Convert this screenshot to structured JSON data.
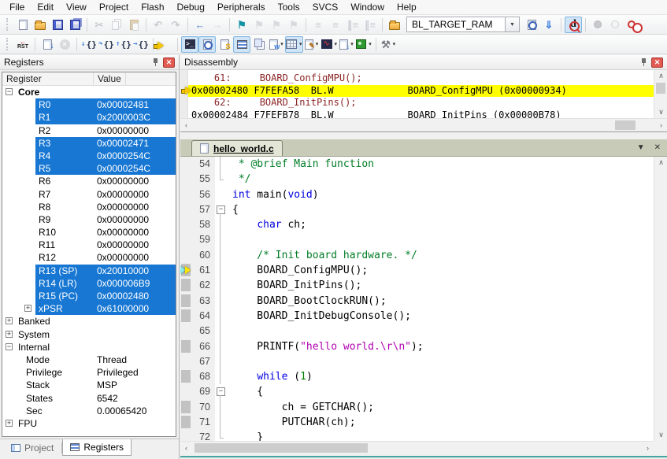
{
  "menu": [
    "File",
    "Edit",
    "View",
    "Project",
    "Flash",
    "Debug",
    "Peripherals",
    "Tools",
    "SVCS",
    "Window",
    "Help"
  ],
  "toolbar": {
    "target": "BL_TARGET_RAM",
    "rst_label": "RST",
    "main": [
      {
        "name": "new-file-icon",
        "kind": "page"
      },
      {
        "name": "open-file-icon",
        "kind": "folder"
      },
      {
        "name": "save-icon",
        "kind": "floppy"
      },
      {
        "name": "save-all-icon",
        "kind": "floppy2"
      },
      {
        "sep": true
      },
      {
        "name": "cut-icon",
        "glyph": "✂",
        "color": "#9a9aa8",
        "disabled": true
      },
      {
        "name": "copy-icon",
        "kind": "copy",
        "disabled": true
      },
      {
        "name": "paste-icon",
        "kind": "paste",
        "disabled": true
      },
      {
        "sep": true
      },
      {
        "name": "undo-icon",
        "glyph": "↶",
        "color": "#9a9aa8",
        "disabled": true
      },
      {
        "name": "redo-icon",
        "glyph": "↷",
        "color": "#9a9aa8",
        "disabled": true
      },
      {
        "sep": true
      },
      {
        "name": "navigate-back-icon",
        "glyph": "←",
        "color": "#4b78c8"
      },
      {
        "name": "navigate-forward-icon",
        "glyph": "→",
        "color": "#b2b2ba",
        "disabled": true
      },
      {
        "sep": true
      },
      {
        "name": "bookmark-toggle-icon",
        "glyph": "⚑",
        "color": "#1391a5"
      },
      {
        "name": "bookmark-prev-icon",
        "glyph": "⚑",
        "color": "#b8b8c0",
        "disabled": true
      },
      {
        "name": "bookmark-next-icon",
        "glyph": "⚑",
        "color": "#b8b8c0",
        "disabled": true
      },
      {
        "name": "bookmark-clear-icon",
        "glyph": "⚑",
        "color": "#b8b8c0",
        "disabled": true
      },
      {
        "sep": true
      },
      {
        "name": "indent-icon",
        "glyph": "≡",
        "color": "#9aa0ae",
        "disabled": true
      },
      {
        "name": "unindent-icon",
        "glyph": "≡",
        "color": "#9aa0ae",
        "disabled": true
      },
      {
        "name": "comment-selection-icon",
        "glyph": "∥≡",
        "color": "#9aa0ae",
        "disabled": true
      },
      {
        "name": "uncomment-selection-icon",
        "glyph": "∥≡",
        "color": "#9aa0ae",
        "disabled": true
      },
      {
        "sep": true
      },
      {
        "name": "target-folder-icon",
        "kind": "folder"
      },
      {
        "name": "target-select",
        "kind": "combo"
      },
      {
        "name": "file-options-icon",
        "kind": "pagemag"
      },
      {
        "name": "find-in-files-icon",
        "glyph": "⇓",
        "color": "#3a7edc"
      },
      {
        "sep": true
      },
      {
        "name": "debug-session-icon",
        "kind": "debugd",
        "active": true
      },
      {
        "sep": true
      },
      {
        "name": "breakpoint-toggle-icon",
        "kind": "bp-f",
        "disabled": true
      },
      {
        "name": "breakpoint-enable-icon",
        "kind": "bp-h",
        "disabled": true
      },
      {
        "name": "breakpoint-kill-all-icon",
        "kind": "bp-k"
      }
    ],
    "debug": [
      {
        "name": "reset-icon",
        "kind": "rst"
      },
      {
        "sep": true
      },
      {
        "name": "run-icon",
        "kind": "run"
      },
      {
        "name": "stop-icon",
        "kind": "stop",
        "glyph": "✕",
        "disabled": true
      },
      {
        "sep": true
      },
      {
        "name": "step-into-icon",
        "kind": "braces",
        "sub": "↓"
      },
      {
        "name": "step-over-icon",
        "kind": "braces",
        "sub": "↷"
      },
      {
        "name": "step-out-icon",
        "kind": "braces",
        "sub": "↑"
      },
      {
        "name": "run-to-cursor-icon",
        "kind": "braces",
        "sub": "→"
      },
      {
        "sep": true
      },
      {
        "name": "show-next-statement-icon",
        "kind": "nextarrow"
      },
      {
        "sep": true
      },
      {
        "name": "command-window-icon",
        "kind": "cmd",
        "glyph": ">_",
        "active": true
      },
      {
        "name": "disassembly-window-icon",
        "kind": "pagemag2",
        "active": true
      },
      {
        "name": "symbol-window-icon",
        "kind": "page-s",
        "ov": "S",
        "ovcolor": "#e0a000"
      },
      {
        "name": "registers-window-icon",
        "kind": "reglines",
        "active": true
      },
      {
        "name": "callstack-window-icon",
        "kind": "pages"
      },
      {
        "name": "watch-window-icon",
        "kind": "page-s",
        "ov": "w",
        "ovcolor": "#3a7edc",
        "dropdown": true
      },
      {
        "name": "memory-window-icon",
        "kind": "grid",
        "dropdown": true,
        "active": true
      },
      {
        "name": "serial-window-icon",
        "kind": "page-s",
        "ov": "✎",
        "ovcolor": "#b06a10",
        "dropdown": true
      },
      {
        "name": "analysis-window-icon",
        "kind": "analysis",
        "glyph": "∿",
        "dropdown": true
      },
      {
        "name": "trace-window-icon",
        "kind": "page-s",
        "ov": "↓",
        "ovcolor": "#3a7edc",
        "dropdown": true
      },
      {
        "name": "system-viewer-icon",
        "kind": "chip",
        "dropdown": true
      },
      {
        "sep": true
      },
      {
        "name": "debug-settings-icon",
        "glyph": "⚒",
        "color": "#7a7a84",
        "dropdown": true
      }
    ]
  },
  "registers_panel": {
    "title": "Registers",
    "columns": [
      "Register",
      "Value"
    ],
    "rows": [
      {
        "label": "Core",
        "lvl": 0,
        "exp": "−",
        "grp": true
      },
      {
        "label": "R0",
        "value": "0x00002481",
        "lvl": 1,
        "sel": true
      },
      {
        "label": "R1",
        "value": "0x2000003C",
        "lvl": 1,
        "sel": true
      },
      {
        "label": "R2",
        "value": "0x00000000",
        "lvl": 1
      },
      {
        "label": "R3",
        "value": "0x00002471",
        "lvl": 1,
        "sel": true
      },
      {
        "label": "R4",
        "value": "0x0000254C",
        "lvl": 1,
        "sel": true
      },
      {
        "label": "R5",
        "value": "0x0000254C",
        "lvl": 1,
        "sel": true
      },
      {
        "label": "R6",
        "value": "0x00000000",
        "lvl": 1
      },
      {
        "label": "R7",
        "value": "0x00000000",
        "lvl": 1
      },
      {
        "label": "R8",
        "value": "0x00000000",
        "lvl": 1
      },
      {
        "label": "R9",
        "value": "0x00000000",
        "lvl": 1
      },
      {
        "label": "R10",
        "value": "0x00000000",
        "lvl": 1
      },
      {
        "label": "R11",
        "value": "0x00000000",
        "lvl": 1
      },
      {
        "label": "R12",
        "value": "0x00000000",
        "lvl": 1
      },
      {
        "label": "R13 (SP)",
        "value": "0x20010000",
        "lvl": 1,
        "sel": true
      },
      {
        "label": "R14 (LR)",
        "value": "0x000006B9",
        "lvl": 1,
        "sel": true
      },
      {
        "label": "R15 (PC)",
        "value": "0x00002480",
        "lvl": 1,
        "sel": true
      },
      {
        "label": "xPSR",
        "value": "0x61000000",
        "lvl": 1,
        "sel": true,
        "exp": "+"
      },
      {
        "label": "Banked",
        "lvl": 0,
        "exp": "+"
      },
      {
        "label": "System",
        "lvl": 0,
        "exp": "+"
      },
      {
        "label": "Internal",
        "lvl": 0,
        "exp": "−"
      },
      {
        "label": "Mode",
        "value": "Thread",
        "lvl": 2
      },
      {
        "label": "Privilege",
        "value": "Privileged",
        "lvl": 2
      },
      {
        "label": "Stack",
        "value": "MSP",
        "lvl": 2
      },
      {
        "label": "States",
        "value": "6542",
        "lvl": 2
      },
      {
        "label": "Sec",
        "value": "0.00065420",
        "lvl": 2
      },
      {
        "label": "FPU",
        "lvl": 0,
        "exp": "+"
      }
    ],
    "tabs": [
      {
        "label": "Project",
        "icon": "project-icon"
      },
      {
        "label": "Registers",
        "icon": "registers-icon",
        "active": true
      }
    ]
  },
  "disassembly": {
    "title": "Disassembly",
    "rows": [
      {
        "kind": "src",
        "text": "    61:     BOARD_ConfigMPU();"
      },
      {
        "kind": "asm",
        "current": true,
        "text": "0x00002480 F7FEFA58  BL.W             BOARD_ConfigMPU (0x00000934)"
      },
      {
        "kind": "src",
        "text": "    62:     BOARD_InitPins();"
      },
      {
        "kind": "asm",
        "text": "0x00002484 F7FEFB78  BL.W             BOARD_InitPins (0x00000B78)"
      }
    ]
  },
  "editor": {
    "tab": "hello_world.c",
    "lines": [
      {
        "no": 54,
        "fold": "line",
        "seg": [
          [
            " * @brief Main function",
            "c"
          ]
        ]
      },
      {
        "no": 55,
        "fold": "end",
        "seg": [
          [
            " */",
            "c"
          ]
        ]
      },
      {
        "no": 56,
        "fold": "",
        "seg": [
          [
            "int",
            "k"
          ],
          [
            " main(",
            "p"
          ],
          [
            "void",
            "k"
          ],
          [
            ")",
            "p"
          ]
        ]
      },
      {
        "no": 57,
        "fold": "box",
        "seg": [
          [
            "{",
            "p"
          ]
        ]
      },
      {
        "no": 58,
        "fold": "line",
        "seg": [
          [
            "    ",
            "p"
          ],
          [
            "char",
            "k"
          ],
          [
            " ch;",
            "p"
          ]
        ]
      },
      {
        "no": 59,
        "fold": "line",
        "seg": []
      },
      {
        "no": 60,
        "fold": "line",
        "seg": [
          [
            "    /* Init board hardware. */",
            "c"
          ]
        ]
      },
      {
        "no": 61,
        "fold": "line",
        "exec": true,
        "cur": true,
        "seg": [
          [
            "    BOARD_ConfigMPU();",
            "p"
          ]
        ]
      },
      {
        "no": 62,
        "fold": "line",
        "exec": true,
        "seg": [
          [
            "    BOARD_InitPins();",
            "p"
          ]
        ]
      },
      {
        "no": 63,
        "fold": "line",
        "exec": true,
        "seg": [
          [
            "    BOARD_BootClockRUN();",
            "p"
          ]
        ]
      },
      {
        "no": 64,
        "fold": "line",
        "exec": true,
        "seg": [
          [
            "    BOARD_InitDebugConsole();",
            "p"
          ]
        ]
      },
      {
        "no": 65,
        "fold": "line",
        "seg": []
      },
      {
        "no": 66,
        "fold": "line",
        "exec": true,
        "seg": [
          [
            "    PRINTF(",
            "p"
          ],
          [
            "\"hello world.\\r\\n\"",
            "s"
          ],
          [
            ");",
            "p"
          ]
        ]
      },
      {
        "no": 67,
        "fold": "line",
        "seg": []
      },
      {
        "no": 68,
        "fold": "line",
        "exec": true,
        "seg": [
          [
            "    ",
            "p"
          ],
          [
            "while",
            "k"
          ],
          [
            " (",
            "p"
          ],
          [
            "1",
            "n"
          ],
          [
            ")",
            "p"
          ]
        ]
      },
      {
        "no": 69,
        "fold": "box",
        "seg": [
          [
            "    {",
            "p"
          ]
        ]
      },
      {
        "no": 70,
        "fold": "line",
        "exec": true,
        "seg": [
          [
            "        ch = GETCHAR();",
            "p"
          ]
        ]
      },
      {
        "no": 71,
        "fold": "line",
        "exec": true,
        "seg": [
          [
            "        PUTCHAR(ch);",
            "p"
          ]
        ]
      },
      {
        "no": 72,
        "fold": "end",
        "seg": [
          [
            "    }",
            "p"
          ]
        ]
      }
    ]
  }
}
